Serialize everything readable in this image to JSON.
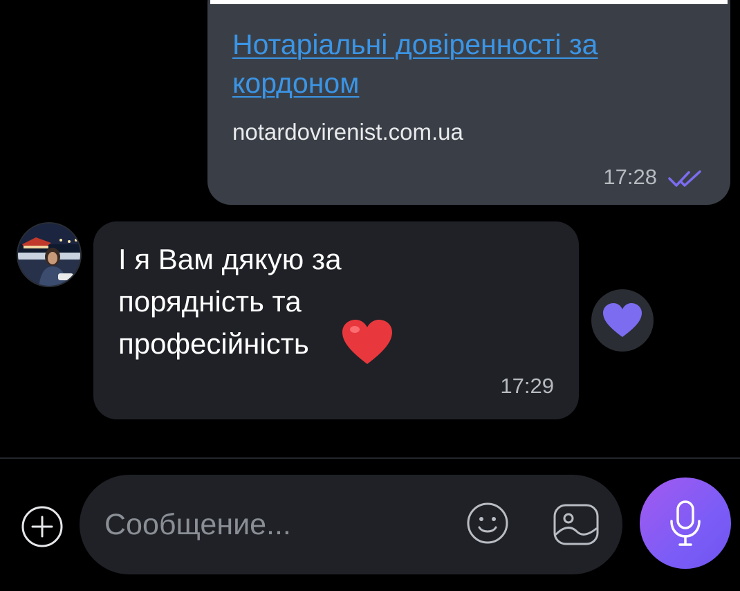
{
  "messages": {
    "outgoing": {
      "link_title": "Нотаріальні довіренності за кордоном",
      "link_domain": "notardovirenist.com.ua",
      "time": "17:28",
      "status_icon": "double-check-read-icon"
    },
    "incoming": {
      "text": "І я Вам дякую за\nпорядність та\nпрофесійність",
      "emoji": "❤️",
      "time": "17:29",
      "reaction": "purple-heart"
    }
  },
  "composer": {
    "placeholder": "Сообщение...",
    "value": "",
    "icons": {
      "attach": "plus-circle-icon",
      "emoji": "smile-icon",
      "gallery": "image-icon",
      "mic": "microphone-icon"
    }
  },
  "colors": {
    "background": "#000000",
    "outgoing_bubble": "#3a3f47",
    "incoming_bubble": "#1f2126",
    "link": "#3b95e6",
    "accent_purple": "#7c5cf6",
    "read_ticks": "#7b6cf0"
  }
}
